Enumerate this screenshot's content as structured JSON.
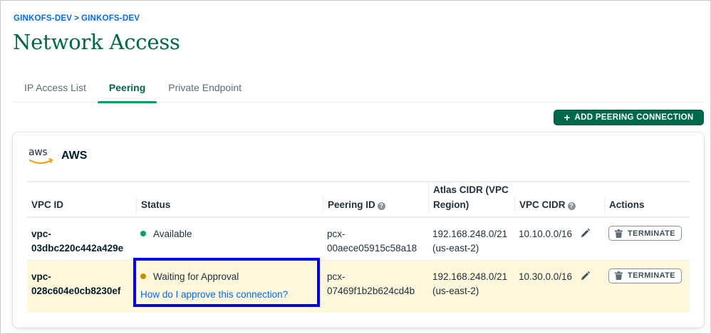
{
  "breadcrumb": {
    "org": "GINKOFS-DEV",
    "separator": ">",
    "project": "GINKOFS-DEV"
  },
  "page_title": "Network Access",
  "tabs": [
    {
      "label": "IP Access List",
      "active": false
    },
    {
      "label": "Peering",
      "active": true
    },
    {
      "label": "Private Endpoint",
      "active": false
    }
  ],
  "add_button": {
    "icon": "plus-icon",
    "label": "ADD PEERING CONNECTION"
  },
  "provider": {
    "logo_text": "aws",
    "name": "AWS"
  },
  "table": {
    "columns": {
      "vpc_id": "VPC ID",
      "status": "Status",
      "peering_id": "Peering ID",
      "atlas_cidr": "Atlas CIDR (VPC Region)",
      "vpc_cidr": "VPC CIDR",
      "actions": "Actions"
    },
    "rows": [
      {
        "vpc_id": "vpc-03dbc220c442a429e",
        "status": "Available",
        "status_color": "#00a35c",
        "peering_id": "pcx-00aece05915c58a18",
        "atlas_cidr": "192.168.248.0/21 (us-east-2)",
        "vpc_cidr": "10.10.0.0/16",
        "action": "TERMINATE"
      },
      {
        "vpc_id": "vpc-028c604e0cb8230ef",
        "status": "Waiting for Approval",
        "status_color": "#c78e00",
        "status_link": "How do I approve this connection?",
        "peering_id": "pcx-07469f1b2b624cd4b",
        "atlas_cidr": "192.168.248.0/21 (us-east-2)",
        "vpc_cidr": "10.30.0.0/16",
        "action": "TERMINATE"
      }
    ]
  },
  "colors": {
    "brand_green": "#00684a",
    "link_blue": "#016bf8",
    "highlight_row": "#fef7db",
    "annotation_box": "#0000ee"
  }
}
